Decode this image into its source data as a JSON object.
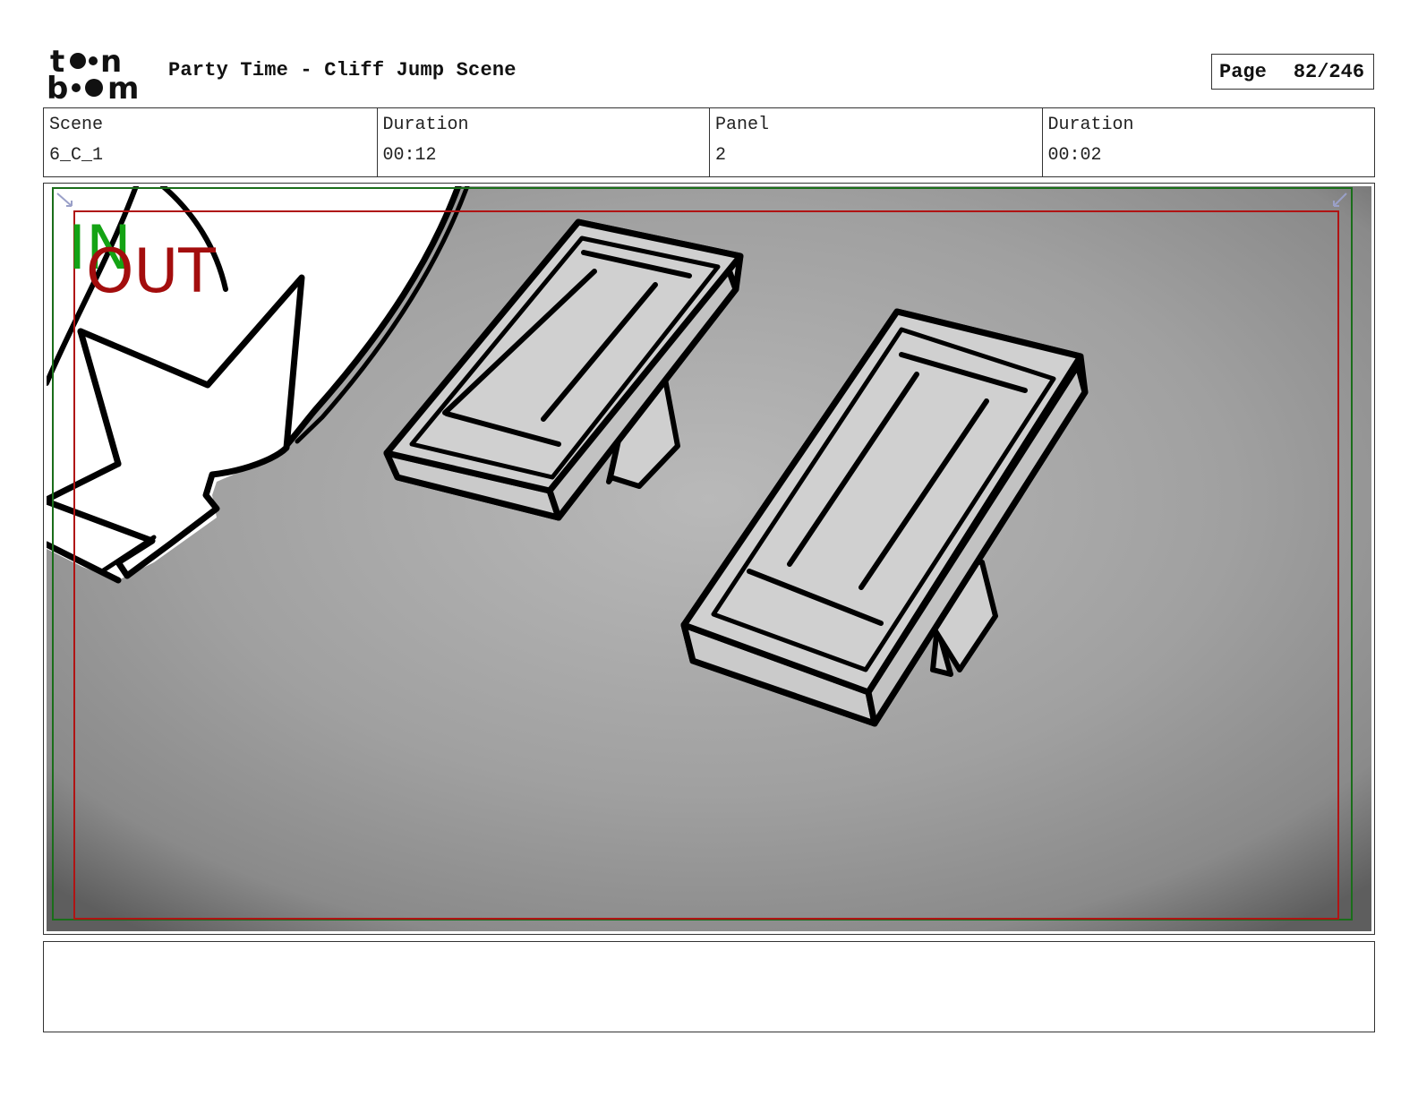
{
  "header": {
    "logo_text": "toon boom",
    "title": "Party Time - Cliff Jump Scene",
    "page_label": "Page",
    "page_number": "82/246"
  },
  "info": {
    "scene_label": "Scene",
    "scene_value": "6_C_1",
    "scene_duration_label": "Duration",
    "scene_duration_value": "00:12",
    "panel_label": "Panel",
    "panel_value": "2",
    "panel_duration_label": "Duration",
    "panel_duration_value": "00:02"
  },
  "panel": {
    "in_marker": "IN",
    "out_marker": "OUT",
    "in_color": "#14a314",
    "out_color": "#a30d0d"
  },
  "notes": {
    "text": ""
  }
}
